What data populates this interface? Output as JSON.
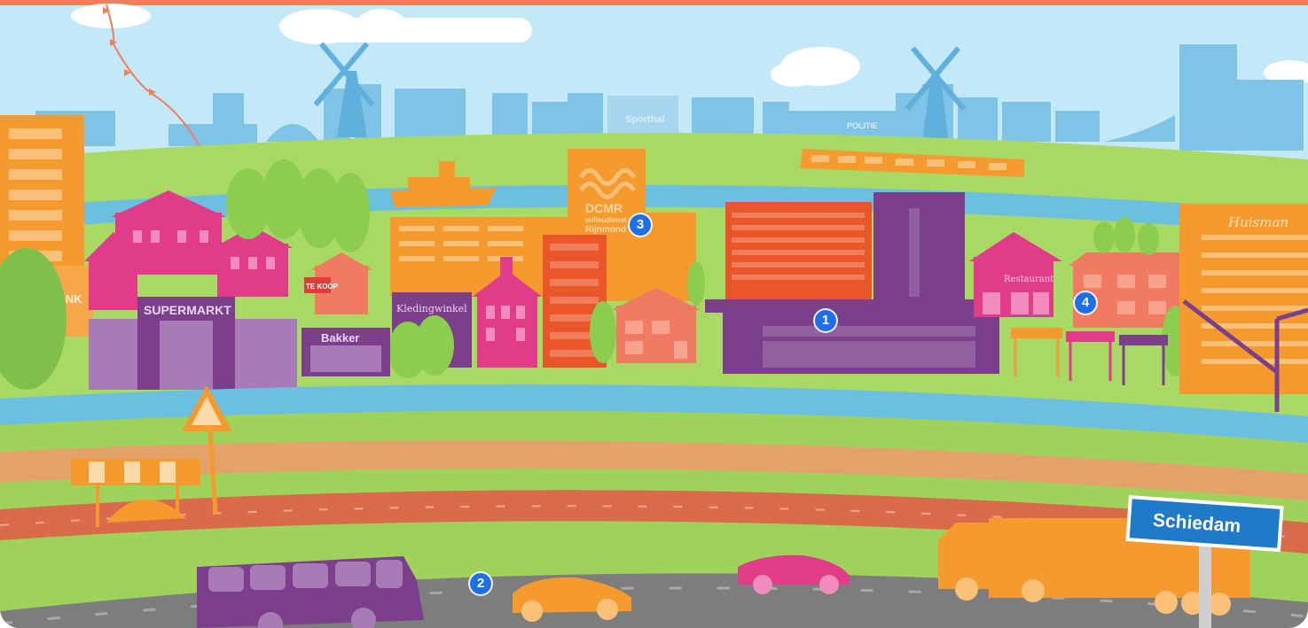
{
  "colors": {
    "top_bar": "#f27d5a",
    "sky": "#bde7f8",
    "grass": "#9fd25b",
    "grass_dark": "#7fc04b",
    "river": "#6bbfe0",
    "purple": "#7b3f8c",
    "pink": "#e03c8a",
    "orange": "#f59a2f",
    "coral": "#f07a62",
    "road": "#7d7d7d",
    "marker": "#1e6fe8",
    "sign_blue": "#1f7ac8"
  },
  "skyline": {
    "sporthal": "Sporthal",
    "politie": "POLITIE"
  },
  "buildings": {
    "bank": "BANK",
    "supermarkt": "SUPERMARKT",
    "bakker": "Bakker",
    "kledingwinkel": "Kledingwinkel",
    "te_koop": "TE KOOP",
    "dcmr_logo": "DCMR",
    "dcmr_sub1": "milieudienst",
    "dcmr_sub2": "Rijnmond",
    "restaurant": "Restaurant",
    "huisman": "Huisman",
    "crane_label": "Huisman"
  },
  "sign": {
    "city": "Schiedam"
  },
  "markers": [
    {
      "label": "1"
    },
    {
      "label": "2"
    },
    {
      "label": "3"
    },
    {
      "label": "4"
    }
  ]
}
